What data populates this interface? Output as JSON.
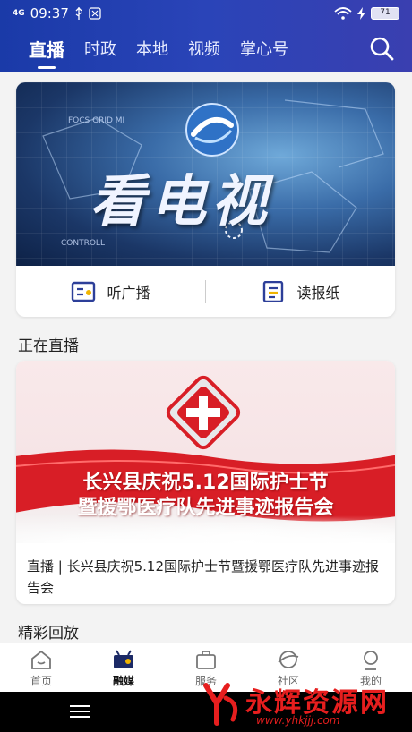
{
  "status_bar": {
    "signal": "4G",
    "time": "09:37",
    "battery": "71"
  },
  "tabs": [
    {
      "label": "直播",
      "active": true
    },
    {
      "label": "时政"
    },
    {
      "label": "本地"
    },
    {
      "label": "视频"
    },
    {
      "label": "掌心号"
    }
  ],
  "banner": {
    "title": "看电视",
    "small_text_1": "FOCS GRID MI",
    "small_text_2": "CONTROLL"
  },
  "actions": [
    {
      "label": "听广播",
      "icon": "radio-icon"
    },
    {
      "label": "读报纸",
      "icon": "newspaper-icon"
    }
  ],
  "sections": {
    "live": "正在直播",
    "replay": "精彩回放"
  },
  "live_card": {
    "banner_line1": "长兴县庆祝5.12国际护士节",
    "banner_line2": "暨援鄂医疗队先进事迹报告会",
    "caption": "直播 | 长兴县庆祝5.12国际护士节暨援鄂医疗队先进事迹报告会"
  },
  "bottom_nav": [
    {
      "label": "首页",
      "icon": "home-icon"
    },
    {
      "label": "融媒",
      "icon": "media-icon",
      "active": true
    },
    {
      "label": "服务",
      "icon": "service-icon"
    },
    {
      "label": "社区",
      "icon": "community-icon"
    },
    {
      "label": "我的",
      "icon": "profile-icon"
    }
  ],
  "watermark": {
    "text": "永辉资源网",
    "url": "www.yhkjjj.com"
  },
  "colors": {
    "header": "#2a44b8",
    "accent_red": "#d81e26",
    "watermark_red": "#e61e1e"
  }
}
